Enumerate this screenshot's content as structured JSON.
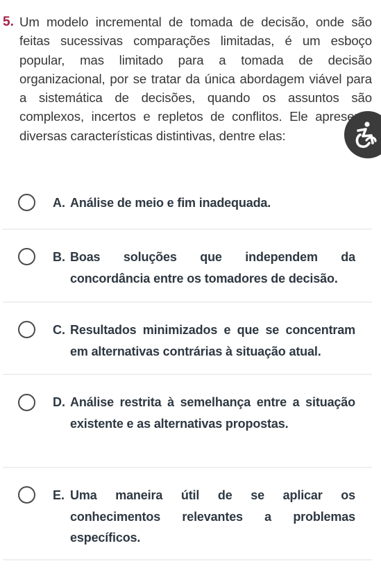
{
  "question": {
    "number": "5.",
    "text": "Um modelo incremental de tomada de decisão, onde são feitas sucessivas comparações limitadas, é um esboço popular, mas limitado para a tomada de decisão organizacional, por se tratar da única abordagem viável para a sistemática de decisões, quando os assuntos são complexos, incertos e repletos de conflitos. Ele apresenta diversas características distintivas, dentre elas:"
  },
  "options": [
    {
      "letter": "A.",
      "text": "Análise de meio e fim inadequada.",
      "selected": false
    },
    {
      "letter": "B.",
      "text": "Boas soluções que independem da concordância entre os tomadores de decisão.",
      "selected": false
    },
    {
      "letter": "C.",
      "text": "Resultados minimizados e que se concentram em alternativas contrárias à situação atual.",
      "selected": false
    },
    {
      "letter": "D.",
      "text": "Análise restrita à semelhança entre a situação existente e as alternativas propostas.",
      "selected": false
    },
    {
      "letter": "E.",
      "text": "Uma maneira útil de se aplicar os conhecimentos relevantes a problemas específicos.",
      "selected": false
    }
  ],
  "accessibility_button": {
    "icon": "accessibility-wheelchair-icon"
  },
  "colors": {
    "question_number": "#a8224a",
    "question_text": "#363636",
    "option_text": "#2e3842",
    "radio_border": "#4a4a4a",
    "divider": "#efefef",
    "accessibility_button_bg": "#3b3b3b"
  }
}
